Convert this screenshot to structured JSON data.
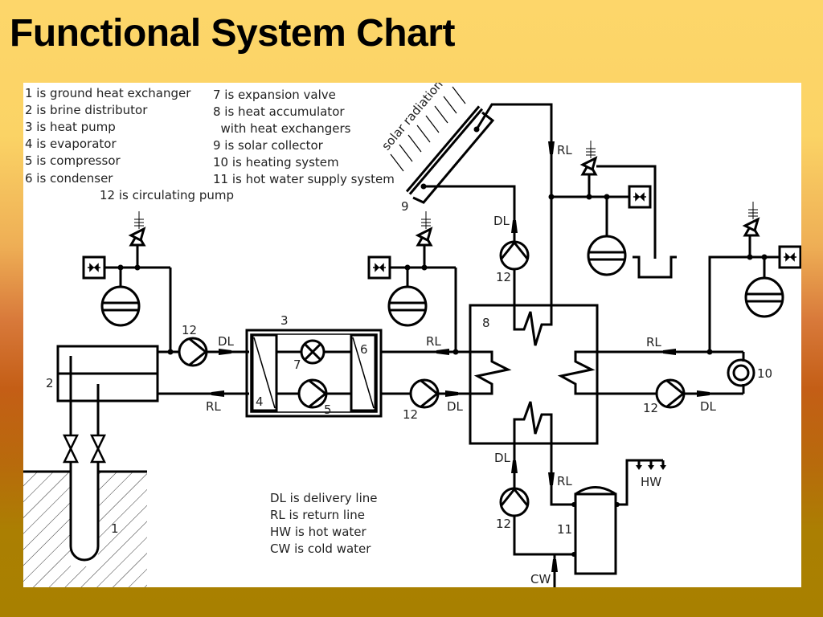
{
  "title": "Functional System Chart",
  "colors": {
    "background_top": "#fdd66a",
    "background_mid": "#c45e16",
    "background_bottom": "#a88000",
    "panel": "#ffffff",
    "line": "#000000"
  },
  "legend_components_left": [
    "1 is ground heat exchanger",
    "2 is brine distributor",
    "3 is heat pump",
    "4 is evaporator",
    "5 is compressor",
    "6 is condenser"
  ],
  "legend_components_right": [
    "7 is expansion valve",
    "8 is heat accumulator",
    "  with heat exchangers",
    "9 is solar collector",
    "10 is heating system",
    "11 is hot water supply system"
  ],
  "legend_pump": "12 is circulating pump",
  "legend_lines": [
    "DL is delivery line",
    "RL is return line",
    "HW is hot water",
    "CW is cold water"
  ],
  "solar_label": "solar radiation",
  "component_numbers": {
    "ground_hx": "1",
    "brine_dist": "2",
    "heat_pump": "3",
    "evaporator": "4",
    "compressor": "5",
    "condenser": "6",
    "expansion_valve": "7",
    "accumulator": "8",
    "solar_collector": "9",
    "heating_system": "10",
    "hot_water_system": "11",
    "pump": "12"
  },
  "line_labels": {
    "dl": "DL",
    "rl": "RL",
    "hw": "HW",
    "cw": "CW"
  }
}
